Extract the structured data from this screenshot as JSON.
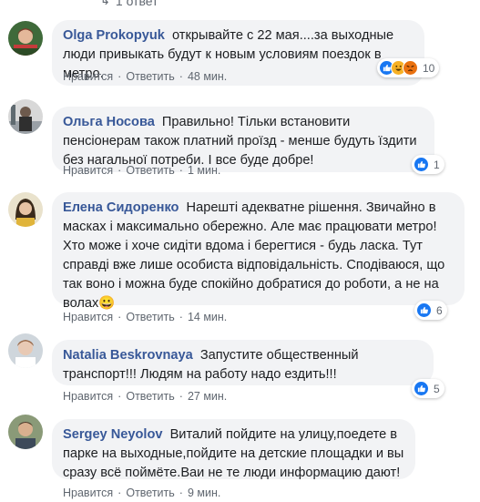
{
  "top": {
    "replies_text": "1 ответ"
  },
  "comments": [
    {
      "author": "Olga Prokopyuk",
      "text": "открывайте с 22 мая....за выходные люди привыкать будут к новым условиям поездок в метро.",
      "like_label": "Нравится",
      "reply_label": "Ответить",
      "time": "48 мин.",
      "reaction_count": "10",
      "reaction_icons": [
        "like-icon",
        "haha-icon",
        "angry-icon"
      ]
    },
    {
      "author": "Ольга Носова",
      "text": "Правильно! Тільки встановити пенсіонерам також платний проїзд - менше будуть їздити без нагальної потреби. І все буде добре!",
      "like_label": "Нравится",
      "reply_label": "Ответить",
      "time": "1 мин.",
      "reaction_count": "1",
      "reaction_icons": [
        "like-icon"
      ]
    },
    {
      "author": "Елена Сидоренко",
      "text": "Нарешті адекватне рішення. Звичайно в масках і максимально обережно. Але має працювати метро! Хто може і хоче сидіти вдома і берегтися - будь ласка. Тут справді вже лише особиста відповідальність. Сподіваюся, що так воно і можна буде спокійно добратися до роботи, а не на волах",
      "emoji": "😀",
      "like_label": "Нравится",
      "reply_label": "Ответить",
      "time": "14 мин.",
      "reaction_count": "6",
      "reaction_icons": [
        "like-icon"
      ]
    },
    {
      "author": "Natalia Beskrovnaya",
      "text": "Запустите общественный транспорт!!! Людям на работу надо ездить!!!",
      "like_label": "Нравится",
      "reply_label": "Ответить",
      "time": "27 мин.",
      "reaction_count": "5",
      "reaction_icons": [
        "like-icon"
      ]
    },
    {
      "author": "Sergey Neyolov",
      "text": "Виталий пойдите на улицу,поедете в парке на выходные,пойдите на детские площадки и вы сразу всё поймёте.Ваи не те люди информацию дают!",
      "like_label": "Нравится",
      "reply_label": "Ответить",
      "time": "9 мин."
    }
  ],
  "colors": {
    "author": "#385898",
    "bubble": "#f2f3f5",
    "meta": "#606770",
    "like": "#1877f2"
  }
}
